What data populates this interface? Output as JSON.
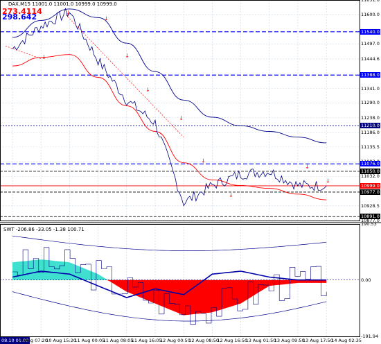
{
  "header": {
    "symbol_info": "DAX,M15  11001.0 11001.0 10999.0 10999.0",
    "value_red": "273.4114",
    "value_blue": "298.642"
  },
  "indicator": {
    "label": "SWT -206.86 -33.05 -1.38 100.71"
  },
  "price_axis": [
    {
      "text": "11651.6",
      "tag": false
    },
    {
      "text": "11600.0",
      "tag": false
    },
    {
      "text": "11540.0",
      "tag": true,
      "color": "#0000ff"
    },
    {
      "text": "11497.0",
      "tag": false
    },
    {
      "text": "11444.6",
      "tag": false
    },
    {
      "text": "11388.0",
      "tag": true,
      "color": "#0000ff"
    },
    {
      "text": "11341.0",
      "tag": false
    },
    {
      "text": "11290.0",
      "tag": false
    },
    {
      "text": "11238.0",
      "tag": false
    },
    {
      "text": "11210.0",
      "tag": true,
      "color": "#000080"
    },
    {
      "text": "11186.0",
      "tag": false
    },
    {
      "text": "11135.5",
      "tag": false
    },
    {
      "text": "11083.0",
      "tag": false
    },
    {
      "text": "11076.0",
      "tag": true,
      "color": "#0000ff"
    },
    {
      "text": "11050.0",
      "tag": true,
      "color": "#000000"
    },
    {
      "text": "11032.0",
      "tag": false
    },
    {
      "text": "10999.0",
      "tag": true,
      "color": "#ff0000"
    },
    {
      "text": "10977.0",
      "tag": true,
      "color": "#000000"
    },
    {
      "text": "10928.5",
      "tag": false
    },
    {
      "text": "10891.0",
      "tag": true,
      "color": "#000000"
    },
    {
      "text": "10877.0",
      "tag": false
    }
  ],
  "indicator_axis": [
    {
      "text": "190.53"
    },
    {
      "text": "0.00"
    },
    {
      "text": "-191.94"
    }
  ],
  "time_axis": {
    "selected": "08.10 01:00",
    "labels": [
      "10 Aug 07:20",
      "10 Aug 15:20",
      "11 Aug 00:05",
      "11 Aug 08:05",
      "11 Aug 16:05",
      "12 Aug 00:50",
      "12 Aug 08:50",
      "12 Aug 16:50",
      "13 Aug 01:50",
      "13 Aug 09:50",
      "13 Aug 17:50",
      "14 Aug 02:35"
    ]
  },
  "colors": {
    "background": "#ffffff",
    "grid": "#c8d7e6",
    "price_line": "#000080",
    "ma_slow": "#00008b",
    "ma_fast": "#ff0000",
    "signal": "#ff0000",
    "hist_positive": "#40e0d0",
    "hist_negative": "#ff0000"
  },
  "chart_data": [
    {
      "type": "line",
      "title": "DAX,M15",
      "xlabel": "",
      "ylabel": "",
      "ylim": [
        10877,
        11651.6
      ],
      "x": [
        "10 Aug 07:20",
        "10 Aug 15:20",
        "11 Aug 00:05",
        "11 Aug 08:05",
        "11 Aug 16:05",
        "12 Aug 00:50",
        "12 Aug 08:50",
        "12 Aug 16:50",
        "13 Aug 01:50",
        "13 Aug 09:50",
        "13 Aug 17:50",
        "14 Aug 02:35"
      ],
      "series": [
        {
          "values": [
            11480,
            11560,
            11610,
            11440,
            11300,
            11220,
            10940,
            11000,
            11040,
            11050,
            11000,
            10999
          ]
        },
        {
          "values": [
            11520,
            11580,
            11620,
            11590,
            11500,
            11400,
            11300,
            11240,
            11210,
            11190,
            11170,
            11150
          ]
        },
        {
          "values": [
            11420,
            11450,
            11460,
            11380,
            11280,
            11190,
            11080,
            11020,
            11000,
            10990,
            10970,
            10950
          ]
        }
      ],
      "horizontal_levels": [
        11540.0,
        11388.0,
        11210.0,
        11076.0,
        11050.0,
        10999.0,
        10977.0,
        10891.0
      ]
    },
    {
      "type": "area",
      "title": "SWT",
      "ylim": [
        -191.94,
        190.53
      ],
      "x": [
        "10 Aug 07:20",
        "10 Aug 15:20",
        "11 Aug 00:05",
        "11 Aug 08:05",
        "11 Aug 16:05",
        "12 Aug 00:50",
        "12 Aug 08:50",
        "12 Aug 16:50",
        "13 Aug 01:50",
        "13 Aug 09:50",
        "13 Aug 17:50",
        "14 Aug 02:35"
      ],
      "series": [
        {
          "values": [
            60,
            70,
            60,
            20,
            -40,
            -80,
            -120,
            -110,
            -80,
            -20,
            -10,
            -10
          ]
        },
        {
          "values": [
            10,
            30,
            20,
            -20,
            -60,
            -30,
            -50,
            20,
            30,
            10,
            0,
            0
          ]
        }
      ]
    }
  ]
}
